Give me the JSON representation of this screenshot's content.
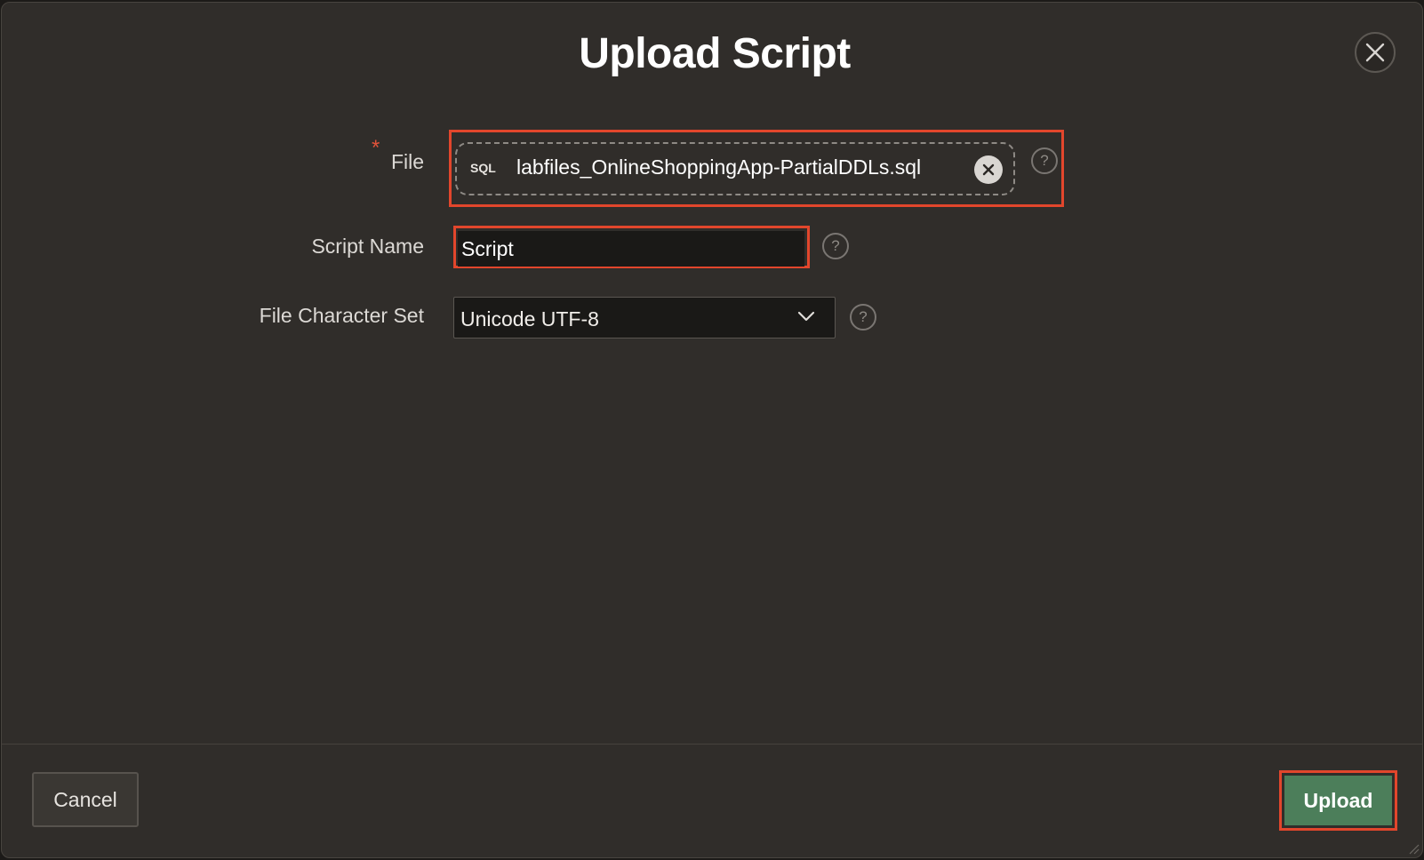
{
  "dialog": {
    "title": "Upload Script",
    "close_icon": "close-icon"
  },
  "form": {
    "file": {
      "label": "File",
      "required_marker": "*",
      "file_type_tag": "SQL",
      "file_name": "labfiles_OnlineShoppingApp-PartialDDLs.sql",
      "clear_icon": "clear-x-icon",
      "help_icon": "help-question-icon"
    },
    "script_name": {
      "label": "Script Name",
      "value": "Script",
      "help_icon": "help-question-icon"
    },
    "charset": {
      "label": "File Character Set",
      "selected": "Unicode UTF-8",
      "dropdown_icon": "chevron-down-icon",
      "help_icon": "help-question-icon"
    }
  },
  "footer": {
    "cancel_label": "Cancel",
    "upload_label": "Upload"
  },
  "colors": {
    "dialog_bg": "#302d2a",
    "highlight": "#e2462c",
    "upload_button": "#4c7e5a",
    "required_asterisk": "#e1533a"
  }
}
